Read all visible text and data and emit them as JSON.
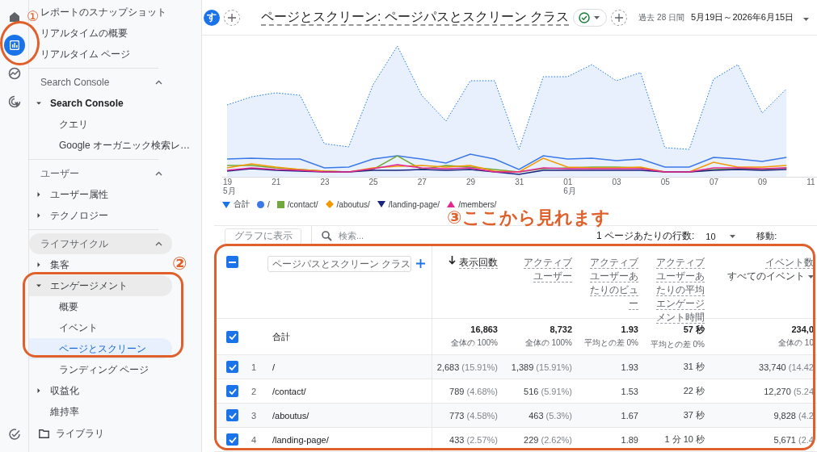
{
  "rail": {
    "items": [
      {
        "kind": "home",
        "selected": false
      },
      {
        "kind": "reports",
        "selected": true
      },
      {
        "kind": "explore",
        "selected": false
      },
      {
        "kind": "advertising",
        "selected": false
      }
    ],
    "bottom": {
      "kind": "admin"
    }
  },
  "sidebar": {
    "top_items": [
      {
        "label": "レポートのスナップショット"
      },
      {
        "label": "リアルタイムの概要"
      },
      {
        "label": "リアルタイム ページ"
      }
    ],
    "sections": [
      {
        "title": "Search Console",
        "expanded": true,
        "highlighted": false,
        "items": [
          {
            "label": "Search Console",
            "kind": "group",
            "expanded": true,
            "highlighted": false,
            "bold": true,
            "children": [
              {
                "label": "クエリ",
                "selected": false
              },
              {
                "label": "Google オーガニック検索レ…",
                "selected": false
              }
            ]
          }
        ]
      },
      {
        "title": "ユーザー",
        "expanded": true,
        "highlighted": false,
        "items": [
          {
            "label": "ユーザー属性",
            "kind": "group",
            "expanded": false,
            "highlighted": false,
            "bold": false
          },
          {
            "label": "テクノロジー",
            "kind": "group",
            "expanded": false,
            "highlighted": false,
            "bold": false
          }
        ]
      },
      {
        "title": "ライフサイクル",
        "expanded": true,
        "highlighted": true,
        "items": [
          {
            "label": "集客",
            "kind": "group",
            "expanded": false,
            "highlighted": false,
            "bold": false
          },
          {
            "label": "エンゲージメント",
            "kind": "group",
            "expanded": true,
            "highlighted": true,
            "bold": false,
            "children": [
              {
                "label": "概要",
                "selected": false
              },
              {
                "label": "イベント",
                "selected": false
              },
              {
                "label": "ページとスクリーン",
                "selected": true
              },
              {
                "label": "ランディング ページ",
                "selected": false
              }
            ]
          },
          {
            "label": "収益化",
            "kind": "group",
            "expanded": false,
            "highlighted": false,
            "bold": false
          },
          {
            "label": "維持率",
            "kind": "link",
            "highlighted": false,
            "bold": false
          }
        ]
      }
    ],
    "library": "ライブラリ"
  },
  "header": {
    "avatar": "す",
    "title": "ページとスクリーン: ページパスとスクリーン クラス",
    "range_label": "過去 28 日間",
    "date_range": "5月19日～2026年6月15日"
  },
  "chart": {
    "x_labels": [
      {
        "day": "19",
        "month": "5月"
      },
      {
        "day": "21"
      },
      {
        "day": "23"
      },
      {
        "day": "25"
      },
      {
        "day": "27"
      },
      {
        "day": "29"
      },
      {
        "day": "31"
      },
      {
        "day": "01",
        "month": "6月"
      },
      {
        "day": "03"
      },
      {
        "day": "05"
      },
      {
        "day": "07"
      },
      {
        "day": "09"
      },
      {
        "day": "11"
      }
    ],
    "legend": [
      {
        "label": "合計",
        "kind": "drop",
        "color": "#1a73e8"
      },
      {
        "label": "/",
        "kind": "circle",
        "color": "#3b78e7"
      },
      {
        "label": "/contact/",
        "kind": "square",
        "color": "#72a839"
      },
      {
        "label": "/aboutus/",
        "kind": "diamond",
        "color": "#f29900"
      },
      {
        "label": "/landing-page/",
        "kind": "triangle-down",
        "color": "#1a237e"
      },
      {
        "label": "/members/",
        "kind": "triangle-up",
        "color": "#e52592"
      }
    ]
  },
  "toolbar": {
    "chart_button": {
      "label": "グラフに表示",
      "disabled": true
    },
    "search": {
      "placeholder": "検索..."
    },
    "rows_label": "1 ページあたりの行数:",
    "rows_value": "10",
    "goto_label": "移動:"
  },
  "table": {
    "select_all": {
      "indeterminate": true
    },
    "dimension": "ページパスとスクリーン クラス",
    "columns": [
      {
        "label": "表示回数",
        "sorted": true
      },
      {
        "label": "アクティブユーザー",
        "sorted": false
      },
      {
        "label": "アクティブユーザーあたりのビュー",
        "sorted": false
      },
      {
        "label": "アクティブユーザーあたりの平均エンゲージメント時間",
        "sorted": false
      },
      {
        "label": "イベント数",
        "sub": "すべてのイベント",
        "sorted": false
      }
    ],
    "total": {
      "label": "合計",
      "checked": true,
      "cells": [
        {
          "value": "16,863",
          "note": "全体の 100%"
        },
        {
          "value": "8,732",
          "note": "全体の 100%"
        },
        {
          "value": "1.93",
          "note": "平均との差 0%"
        },
        {
          "value": "57 秒",
          "note": "平均との差 0%"
        },
        {
          "value": "234,0",
          "note": "全体の 10"
        }
      ]
    },
    "rows": [
      {
        "index": "1",
        "path": "/",
        "checked": true,
        "cells": [
          {
            "value": "2,683",
            "share": "(15.91%)"
          },
          {
            "value": "1,389",
            "share": "(15.91%)"
          },
          {
            "value": "1.93"
          },
          {
            "value": "31 秒"
          },
          {
            "value": "33,740",
            "share": "(14.42"
          }
        ]
      },
      {
        "index": "2",
        "path": "/contact/",
        "checked": true,
        "cells": [
          {
            "value": "789",
            "share": "(4.68%)"
          },
          {
            "value": "516",
            "share": "(5.91%)"
          },
          {
            "value": "1.53"
          },
          {
            "value": "22 秒"
          },
          {
            "value": "12,270",
            "share": "(5.24"
          }
        ]
      },
      {
        "index": "3",
        "path": "/aboutus/",
        "checked": true,
        "cells": [
          {
            "value": "773",
            "share": "(4.58%)"
          },
          {
            "value": "463",
            "share": "(5.3%)"
          },
          {
            "value": "1.67"
          },
          {
            "value": "37 秒"
          },
          {
            "value": "9,828",
            "share": "(4.2"
          }
        ]
      },
      {
        "index": "4",
        "path": "/landing-page/",
        "checked": true,
        "cells": [
          {
            "value": "433",
            "share": "(2.57%)"
          },
          {
            "value": "229",
            "share": "(2.62%)"
          },
          {
            "value": "1.89"
          },
          {
            "value": "1 分 10 秒"
          },
          {
            "value": "5,671",
            "share": "(2.4"
          }
        ]
      }
    ]
  },
  "annotations": [
    {
      "kind": "ring",
      "label": "①"
    },
    {
      "kind": "frame",
      "label": "②"
    },
    {
      "kind": "frame",
      "label": "③ここから見れます"
    }
  ]
}
